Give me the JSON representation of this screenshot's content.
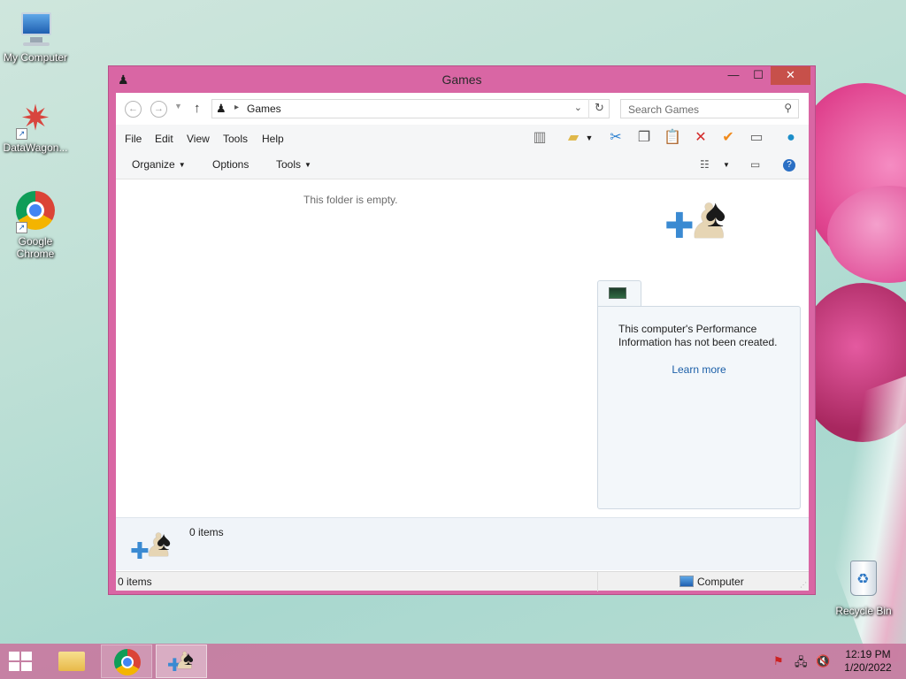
{
  "desktop": {
    "icons": [
      {
        "label": "My Computer",
        "icon": "computer-icon"
      },
      {
        "label": "DataWagon...",
        "icon": "star-icon"
      },
      {
        "label": "Google Chrome",
        "icon": "chrome-icon"
      },
      {
        "label": "Recycle Bin",
        "icon": "recycle-bin-icon"
      }
    ]
  },
  "window": {
    "title": "Games",
    "controls": {
      "minimize": "—",
      "maximize": "☐",
      "close": "✕"
    },
    "address": {
      "path": "Games",
      "search_placeholder": "Search Games"
    },
    "menu": [
      "File",
      "Edit",
      "View",
      "Tools",
      "Help"
    ],
    "toolbar_icons": [
      "layout-icon",
      "folder-options-icon",
      "cut-icon",
      "copy-icon",
      "paste-icon",
      "delete-icon",
      "checkmark-icon",
      "rename-icon",
      "globe-icon"
    ],
    "commands": {
      "organize": "Organize",
      "options": "Options",
      "tools": "Tools"
    },
    "empty_message": "This folder is empty.",
    "performance": {
      "message": "This computer's Performance Information has not been created.",
      "link": "Learn more"
    },
    "details": {
      "count": "0 items"
    },
    "status": {
      "count": "0 items",
      "location": "Computer"
    }
  },
  "taskbar": {
    "clock": {
      "time": "12:19 PM",
      "date": "1/20/2022"
    },
    "tray_icons": [
      "action-center-flag-icon",
      "network-icon",
      "volume-muted-icon"
    ]
  },
  "colors": {
    "window_frame": "#d966a4",
    "close_button": "#c7504a",
    "link": "#1b5fa8"
  }
}
